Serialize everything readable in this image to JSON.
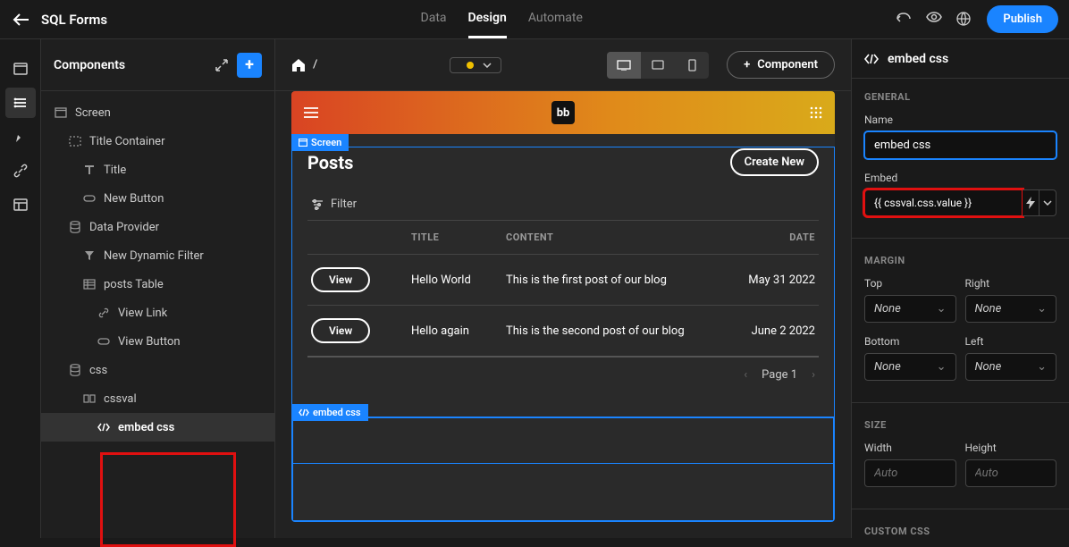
{
  "app": {
    "title": "SQL Forms"
  },
  "topTabs": {
    "data": "Data",
    "design": "Design",
    "automate": "Automate"
  },
  "publish": "Publish",
  "componentsPanel": {
    "title": "Components"
  },
  "tree": {
    "screen": "Screen",
    "titleContainer": "Title Container",
    "title": "Title",
    "newButton": "New Button",
    "dataProvider": "Data Provider",
    "newDynamicFilter": "New Dynamic Filter",
    "postsTable": "posts Table",
    "viewLink": "View Link",
    "viewButton": "View Button",
    "css": "css",
    "cssval": "cssval",
    "embedCss": "embed css"
  },
  "canvas": {
    "breadcrumbSep": "/",
    "componentBtn": "Component",
    "logo": "bb",
    "screenLabel": "Screen",
    "embedLabel": "embed css",
    "postsTitle": "Posts",
    "createNew": "Create New",
    "filter": "Filter",
    "headers": {
      "title": "TITLE",
      "content": "CONTENT",
      "date": "DATE"
    },
    "rows": [
      {
        "action": "View",
        "title": "Hello World",
        "content": "This is the first post of our blog",
        "date": "May 31 2022"
      },
      {
        "action": "View",
        "title": "Hello again",
        "content": "This is the second post of our blog",
        "date": "June 2 2022"
      }
    ],
    "page": "Page 1"
  },
  "rightPanel": {
    "title": "embed css",
    "sections": {
      "general": "GENERAL",
      "margin": "MARGIN",
      "size": "SIZE",
      "custom": "CUSTOM CSS"
    },
    "fields": {
      "nameLabel": "Name",
      "nameValue": "embed css",
      "embedLabel": "Embed",
      "embedValue": "{{ cssval.css.value }}",
      "top": "Top",
      "right": "Right",
      "bottom": "Bottom",
      "left": "Left",
      "none": "None",
      "width": "Width",
      "height": "Height",
      "auto": "Auto"
    }
  }
}
